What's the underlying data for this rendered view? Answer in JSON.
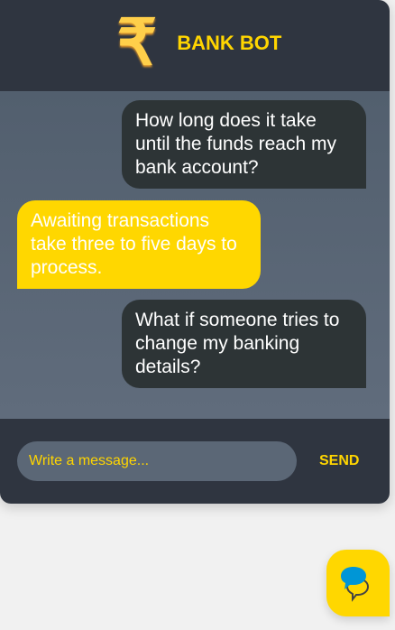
{
  "header": {
    "icon": "rupee-icon",
    "title": "BANK BOT"
  },
  "messages": [
    {
      "sender": "user",
      "text": "How long does it take until the funds reach my bank account?"
    },
    {
      "sender": "bot",
      "text": "Awaiting transactions take three to five days to process."
    },
    {
      "sender": "user",
      "text": "What if someone tries to change my banking details?"
    }
  ],
  "composer": {
    "placeholder": "Write a message...",
    "value": "",
    "send_label": "SEND"
  },
  "launcher": {
    "icon": "chat-bubbles-icon"
  },
  "colors": {
    "accent": "#ffd700",
    "dark": "#2f3540",
    "user_bubble": "#2d3436"
  }
}
